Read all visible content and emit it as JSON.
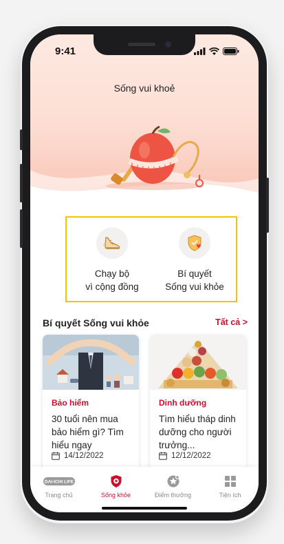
{
  "status": {
    "time": "9:41"
  },
  "header": {
    "title": "Sống vui khoẻ"
  },
  "features": [
    {
      "line1": "Chạy bộ",
      "line2": "vì cộng đồng",
      "icon": "running-shoe-icon"
    },
    {
      "line1": "Bí quyết",
      "line2": "Sống vui khỏe",
      "icon": "shield-heart-icon"
    }
  ],
  "section": {
    "title": "Bí quyết Sống vui khỏe",
    "link": "Tất cả >"
  },
  "articles": [
    {
      "category": "Bảo hiểm",
      "title": "30 tuổi nên mua bảo hiểm gì? Tìm hiểu ngay",
      "date": "14/12/2022"
    },
    {
      "category": "Dinh dưỡng",
      "title": "Tìm hiểu tháp dinh dưỡng cho người trưởng...",
      "date": "12/12/2022"
    }
  ],
  "tabbar": {
    "logo_text": "DAI-ICHI LIFE",
    "items": [
      {
        "label": "Trang chủ"
      },
      {
        "label": "Sống khỏe"
      },
      {
        "label": "Điểm thưởng"
      },
      {
        "label": "Tiện ích"
      }
    ],
    "active_index": 1
  },
  "colors": {
    "brand": "#c8102e",
    "highlight_border": "#f4c300",
    "hero_bg": "#fde9e1"
  }
}
